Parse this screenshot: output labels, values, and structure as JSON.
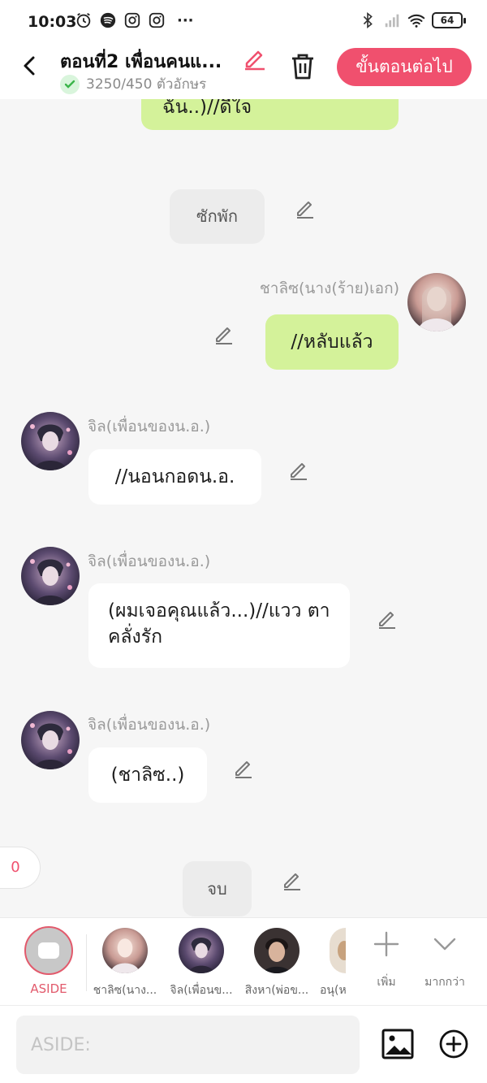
{
  "status_bar": {
    "time": "10:03",
    "battery": "64",
    "more": "···"
  },
  "header": {
    "title": "ตอนที่2 เพื่อนคนแ...",
    "char_count": "3250/450 ตัวอักษร",
    "next_label": "ขั้นตอนต่อไป"
  },
  "messages": [
    {
      "type": "right-cut",
      "text": "ฉัน..)//ดีใจ"
    },
    {
      "type": "scene",
      "text": "ซักพัก"
    },
    {
      "type": "right",
      "speaker": "ชาลิซ(นาง(ร้าย)เอก)",
      "text": "//หลับแล้ว"
    },
    {
      "type": "left",
      "speaker": "จิล(เพื่อนของน.อ.)",
      "text": "//นอนกอดน.อ."
    },
    {
      "type": "left",
      "speaker": "จิล(เพื่อนของน.อ.)",
      "text": "(ผมเจอคุณแล้ว...)//แวว ตาคลั่งรัก"
    },
    {
      "type": "left",
      "speaker": "จิล(เพื่อนของน.อ.)",
      "text": "(ชาลิซ..)"
    },
    {
      "type": "scene",
      "text": "จบ"
    }
  ],
  "counter": "0",
  "characters": [
    {
      "name": "ASIDE",
      "kind": "aside"
    },
    {
      "name": "ชาลิซ(นาง...",
      "kind": "girl"
    },
    {
      "name": "จิล(เพื่อนข...",
      "kind": "boy"
    },
    {
      "name": "สิงหา(พ่อข...",
      "kind": "man"
    },
    {
      "name": "อนุ(ห",
      "kind": "partial"
    }
  ],
  "tools": {
    "add_label": "เพิ่ม",
    "more_label": "มากกว่า"
  },
  "input": {
    "placeholder": "ASIDE:",
    "value": ""
  },
  "colors": {
    "accent": "#f0506e",
    "green_bubble": "#d4f29a",
    "background": "#f6f6f6"
  }
}
